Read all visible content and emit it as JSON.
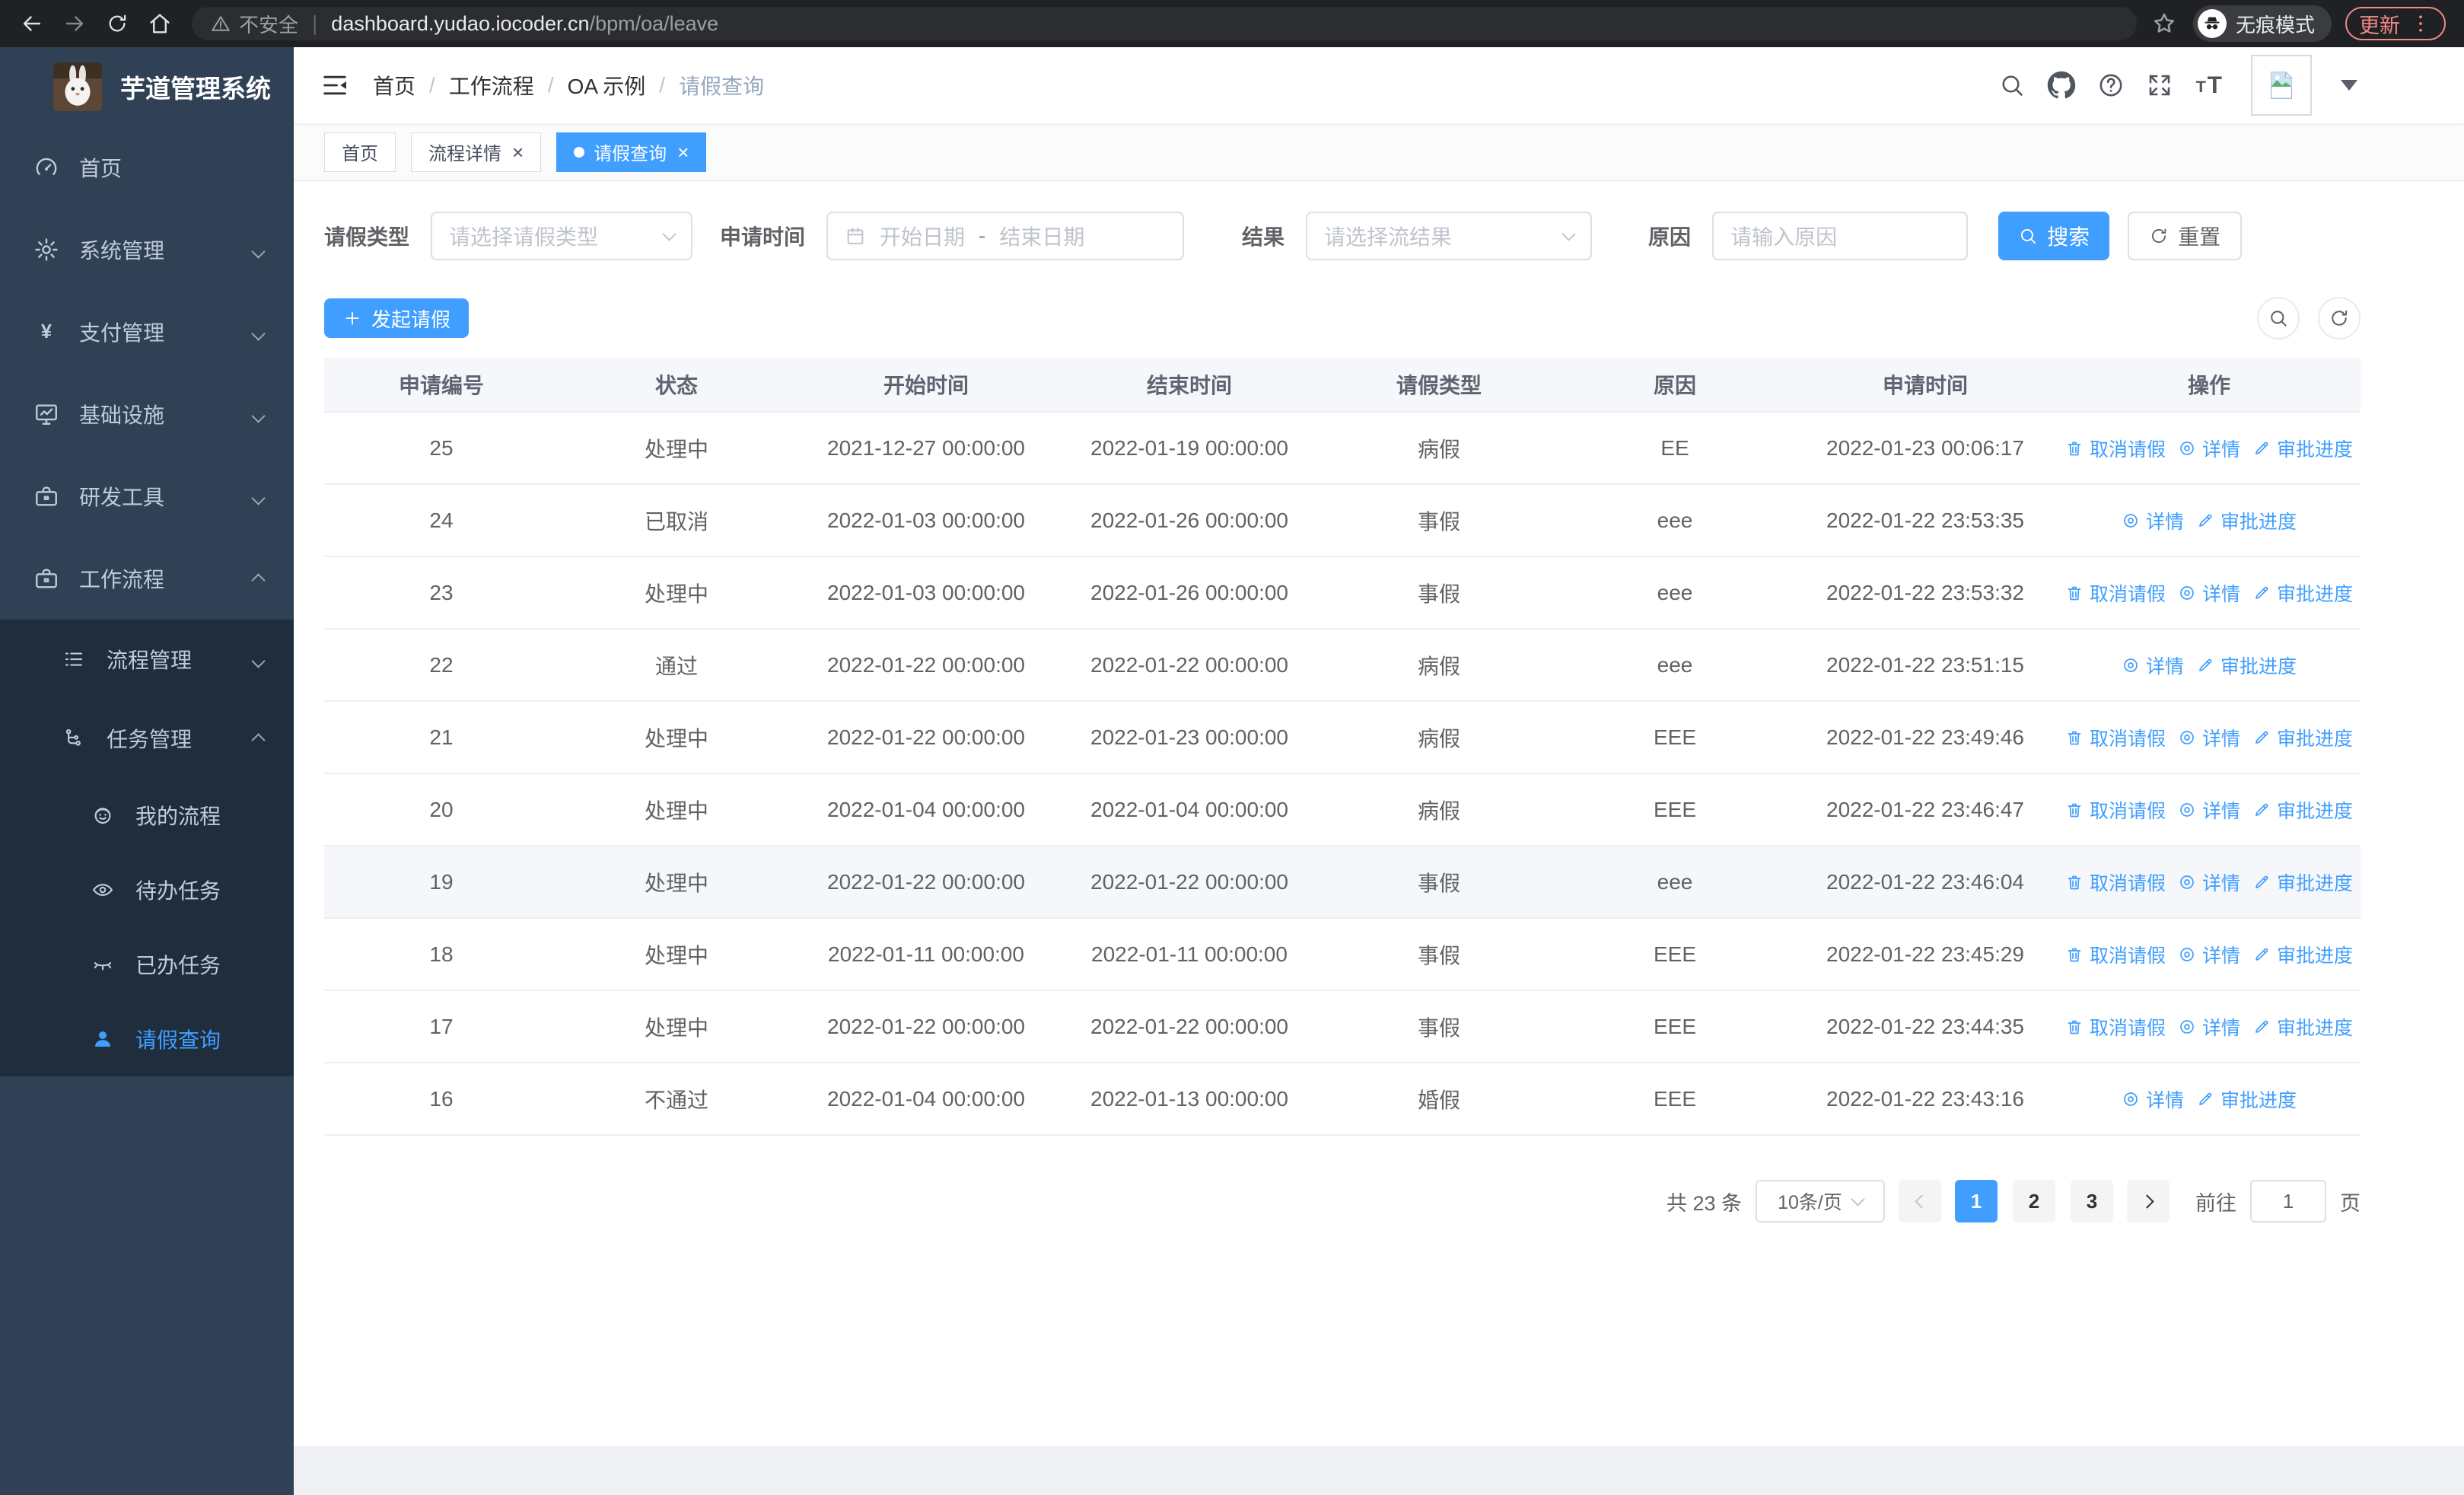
{
  "colors": {
    "accent": "#409eff",
    "sidebar_bg": "#304156",
    "submenu_bg": "#1f2d3d",
    "update_badge": "#f28b82"
  },
  "browser": {
    "security_label": "不安全",
    "url_host": "dashboard.yudao.iocoder.cn",
    "url_path": "/bpm/oa/leave",
    "incognito_label": "无痕模式",
    "update_label": "更新"
  },
  "sidebar": {
    "title": "芋道管理系统",
    "items": [
      {
        "label": "首页",
        "icon": "gauge-icon",
        "level": 0,
        "arrow": null,
        "active": false,
        "sub": false
      },
      {
        "label": "系统管理",
        "icon": "gear-icon",
        "level": 0,
        "arrow": "down",
        "active": false,
        "sub": false
      },
      {
        "label": "支付管理",
        "icon": "yen-icon",
        "level": 0,
        "arrow": "down",
        "active": false,
        "sub": false
      },
      {
        "label": "基础设施",
        "icon": "monitor-icon",
        "level": 0,
        "arrow": "down",
        "active": false,
        "sub": false
      },
      {
        "label": "研发工具",
        "icon": "briefcase-icon",
        "level": 0,
        "arrow": "down",
        "active": false,
        "sub": false
      },
      {
        "label": "工作流程",
        "icon": "briefcase-icon",
        "level": 0,
        "arrow": "up",
        "active": false,
        "sub": false
      },
      {
        "label": "流程管理",
        "icon": "list-icon",
        "level": 1,
        "arrow": "down",
        "active": false,
        "sub": true
      },
      {
        "label": "任务管理",
        "icon": "tree-icon",
        "level": 1,
        "arrow": "up",
        "active": false,
        "sub": true
      },
      {
        "label": "我的流程",
        "icon": "robot-icon",
        "level": 2,
        "arrow": null,
        "active": false,
        "sub": true
      },
      {
        "label": "待办任务",
        "icon": "eye-icon",
        "level": 2,
        "arrow": null,
        "active": false,
        "sub": true
      },
      {
        "label": "已办任务",
        "icon": "eye-closed-icon",
        "level": 2,
        "arrow": null,
        "active": false,
        "sub": true
      },
      {
        "label": "请假查询",
        "icon": "user-icon",
        "level": 2,
        "arrow": null,
        "active": true,
        "sub": true
      }
    ]
  },
  "navbar": {
    "breadcrumbs": [
      "首页",
      "工作流程",
      "OA 示例",
      "请假查询"
    ]
  },
  "tabs": [
    {
      "label": "首页",
      "active": false,
      "closable": false
    },
    {
      "label": "流程详情",
      "active": false,
      "closable": true
    },
    {
      "label": "请假查询",
      "active": true,
      "closable": true
    }
  ],
  "filters": {
    "leave_type_label": "请假类型",
    "leave_type_placeholder": "请选择请假类型",
    "apply_time_label": "申请时间",
    "start_date_placeholder": "开始日期",
    "range_separator": "-",
    "end_date_placeholder": "结束日期",
    "result_label": "结果",
    "result_placeholder": "请选择流结果",
    "reason_label": "原因",
    "reason_placeholder": "请输入原因",
    "search_label": "搜索",
    "reset_label": "重置"
  },
  "toolbar": {
    "create_label": "发起请假"
  },
  "table": {
    "columns": [
      "申请编号",
      "状态",
      "开始时间",
      "结束时间",
      "请假类型",
      "原因",
      "申请时间",
      "操作"
    ],
    "action_labels": {
      "cancel": "取消请假",
      "detail": "详情",
      "progress": "审批进度"
    },
    "rows": [
      {
        "id": "25",
        "status": "处理中",
        "start": "2021-12-27 00:00:00",
        "end": "2022-01-19 00:00:00",
        "type": "病假",
        "reason": "EE",
        "apply": "2022-01-23 00:06:17",
        "actions": [
          "cancel",
          "detail",
          "progress"
        ],
        "highlight": false
      },
      {
        "id": "24",
        "status": "已取消",
        "start": "2022-01-03 00:00:00",
        "end": "2022-01-26 00:00:00",
        "type": "事假",
        "reason": "eee",
        "apply": "2022-01-22 23:53:35",
        "actions": [
          "detail",
          "progress"
        ],
        "highlight": false
      },
      {
        "id": "23",
        "status": "处理中",
        "start": "2022-01-03 00:00:00",
        "end": "2022-01-26 00:00:00",
        "type": "事假",
        "reason": "eee",
        "apply": "2022-01-22 23:53:32",
        "actions": [
          "cancel",
          "detail",
          "progress"
        ],
        "highlight": false
      },
      {
        "id": "22",
        "status": "通过",
        "start": "2022-01-22 00:00:00",
        "end": "2022-01-22 00:00:00",
        "type": "病假",
        "reason": "eee",
        "apply": "2022-01-22 23:51:15",
        "actions": [
          "detail",
          "progress"
        ],
        "highlight": false
      },
      {
        "id": "21",
        "status": "处理中",
        "start": "2022-01-22 00:00:00",
        "end": "2022-01-23 00:00:00",
        "type": "病假",
        "reason": "EEE",
        "apply": "2022-01-22 23:49:46",
        "actions": [
          "cancel",
          "detail",
          "progress"
        ],
        "highlight": false
      },
      {
        "id": "20",
        "status": "处理中",
        "start": "2022-01-04 00:00:00",
        "end": "2022-01-04 00:00:00",
        "type": "病假",
        "reason": "EEE",
        "apply": "2022-01-22 23:46:47",
        "actions": [
          "cancel",
          "detail",
          "progress"
        ],
        "highlight": false
      },
      {
        "id": "19",
        "status": "处理中",
        "start": "2022-01-22 00:00:00",
        "end": "2022-01-22 00:00:00",
        "type": "事假",
        "reason": "eee",
        "apply": "2022-01-22 23:46:04",
        "actions": [
          "cancel",
          "detail",
          "progress"
        ],
        "highlight": true
      },
      {
        "id": "18",
        "status": "处理中",
        "start": "2022-01-11 00:00:00",
        "end": "2022-01-11 00:00:00",
        "type": "事假",
        "reason": "EEE",
        "apply": "2022-01-22 23:45:29",
        "actions": [
          "cancel",
          "detail",
          "progress"
        ],
        "highlight": false
      },
      {
        "id": "17",
        "status": "处理中",
        "start": "2022-01-22 00:00:00",
        "end": "2022-01-22 00:00:00",
        "type": "事假",
        "reason": "EEE",
        "apply": "2022-01-22 23:44:35",
        "actions": [
          "cancel",
          "detail",
          "progress"
        ],
        "highlight": false
      },
      {
        "id": "16",
        "status": "不通过",
        "start": "2022-01-04 00:00:00",
        "end": "2022-01-13 00:00:00",
        "type": "婚假",
        "reason": "EEE",
        "apply": "2022-01-22 23:43:16",
        "actions": [
          "detail",
          "progress"
        ],
        "highlight": false
      }
    ]
  },
  "pagination": {
    "total_label": "共 23 条",
    "page_size": "10条/页",
    "pages": [
      "1",
      "2",
      "3"
    ],
    "active_page": "1",
    "goto_label": "前往",
    "goto_value": "1",
    "goto_suffix": "页"
  }
}
